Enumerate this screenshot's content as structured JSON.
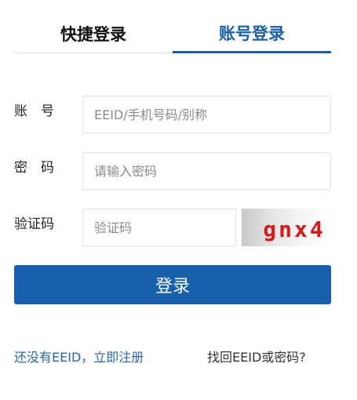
{
  "tabs": [
    {
      "label": "快捷登录",
      "active": false
    },
    {
      "label": "账号登录",
      "active": true
    }
  ],
  "form": {
    "account": {
      "label": "账　号",
      "placeholder": "EEID/手机号码/别称",
      "value": ""
    },
    "password": {
      "label": "密　码",
      "placeholder": "请输入密码",
      "value": ""
    },
    "captcha": {
      "label": "验证码",
      "placeholder": "验证码",
      "value": "",
      "image_text": "gnx4"
    }
  },
  "login_button": "登录",
  "links": {
    "register": "还没有EEID，立即注册",
    "recover": "找回EEID或密码?"
  },
  "colors": {
    "accent": "#1a5fa8",
    "button": "#1860ad",
    "captcha_text": "#d41a1a"
  }
}
